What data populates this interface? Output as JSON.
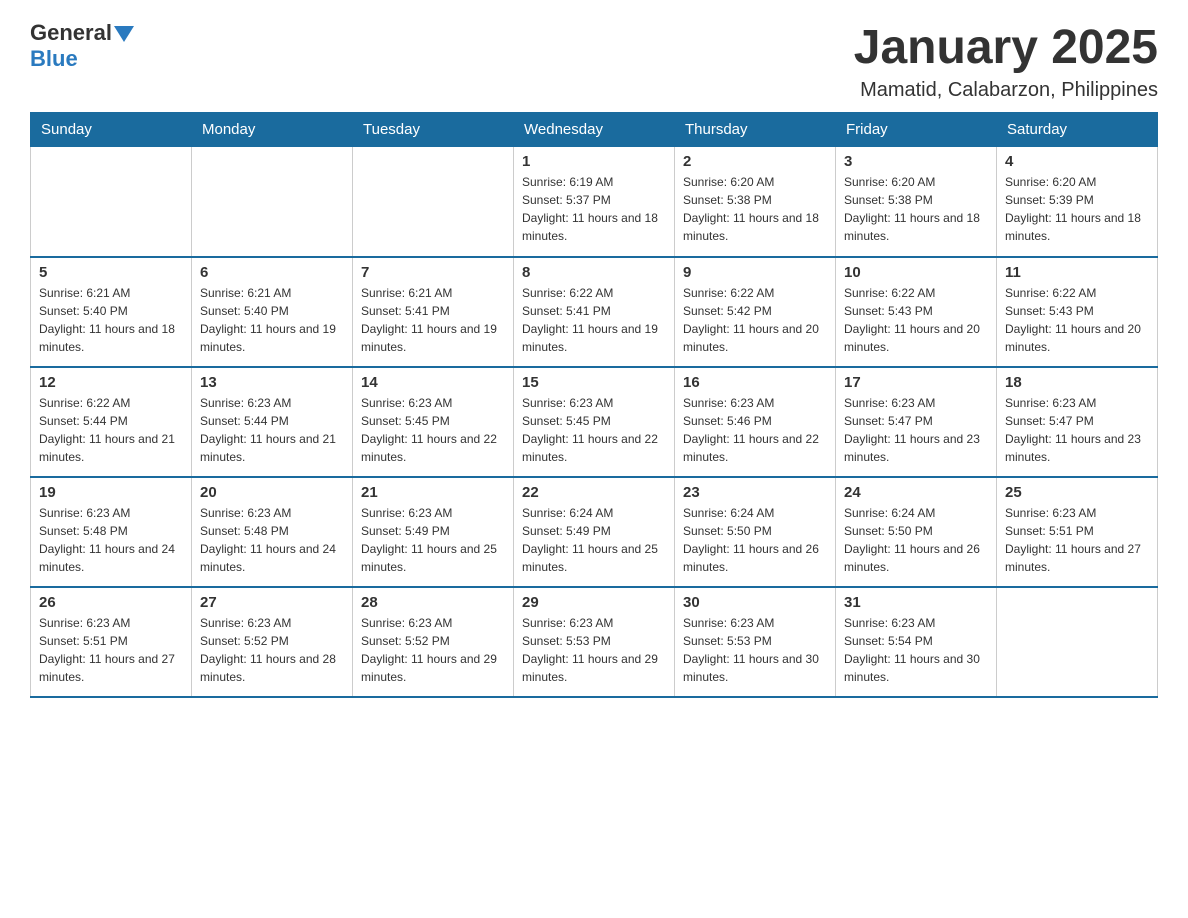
{
  "logo": {
    "general": "General",
    "blue": "Blue"
  },
  "header": {
    "title": "January 2025",
    "subtitle": "Mamatid, Calabarzon, Philippines"
  },
  "days_of_week": [
    "Sunday",
    "Monday",
    "Tuesday",
    "Wednesday",
    "Thursday",
    "Friday",
    "Saturday"
  ],
  "weeks": [
    [
      {
        "day": "",
        "info": ""
      },
      {
        "day": "",
        "info": ""
      },
      {
        "day": "",
        "info": ""
      },
      {
        "day": "1",
        "info": "Sunrise: 6:19 AM\nSunset: 5:37 PM\nDaylight: 11 hours and 18 minutes."
      },
      {
        "day": "2",
        "info": "Sunrise: 6:20 AM\nSunset: 5:38 PM\nDaylight: 11 hours and 18 minutes."
      },
      {
        "day": "3",
        "info": "Sunrise: 6:20 AM\nSunset: 5:38 PM\nDaylight: 11 hours and 18 minutes."
      },
      {
        "day": "4",
        "info": "Sunrise: 6:20 AM\nSunset: 5:39 PM\nDaylight: 11 hours and 18 minutes."
      }
    ],
    [
      {
        "day": "5",
        "info": "Sunrise: 6:21 AM\nSunset: 5:40 PM\nDaylight: 11 hours and 18 minutes."
      },
      {
        "day": "6",
        "info": "Sunrise: 6:21 AM\nSunset: 5:40 PM\nDaylight: 11 hours and 19 minutes."
      },
      {
        "day": "7",
        "info": "Sunrise: 6:21 AM\nSunset: 5:41 PM\nDaylight: 11 hours and 19 minutes."
      },
      {
        "day": "8",
        "info": "Sunrise: 6:22 AM\nSunset: 5:41 PM\nDaylight: 11 hours and 19 minutes."
      },
      {
        "day": "9",
        "info": "Sunrise: 6:22 AM\nSunset: 5:42 PM\nDaylight: 11 hours and 20 minutes."
      },
      {
        "day": "10",
        "info": "Sunrise: 6:22 AM\nSunset: 5:43 PM\nDaylight: 11 hours and 20 minutes."
      },
      {
        "day": "11",
        "info": "Sunrise: 6:22 AM\nSunset: 5:43 PM\nDaylight: 11 hours and 20 minutes."
      }
    ],
    [
      {
        "day": "12",
        "info": "Sunrise: 6:22 AM\nSunset: 5:44 PM\nDaylight: 11 hours and 21 minutes."
      },
      {
        "day": "13",
        "info": "Sunrise: 6:23 AM\nSunset: 5:44 PM\nDaylight: 11 hours and 21 minutes."
      },
      {
        "day": "14",
        "info": "Sunrise: 6:23 AM\nSunset: 5:45 PM\nDaylight: 11 hours and 22 minutes."
      },
      {
        "day": "15",
        "info": "Sunrise: 6:23 AM\nSunset: 5:45 PM\nDaylight: 11 hours and 22 minutes."
      },
      {
        "day": "16",
        "info": "Sunrise: 6:23 AM\nSunset: 5:46 PM\nDaylight: 11 hours and 22 minutes."
      },
      {
        "day": "17",
        "info": "Sunrise: 6:23 AM\nSunset: 5:47 PM\nDaylight: 11 hours and 23 minutes."
      },
      {
        "day": "18",
        "info": "Sunrise: 6:23 AM\nSunset: 5:47 PM\nDaylight: 11 hours and 23 minutes."
      }
    ],
    [
      {
        "day": "19",
        "info": "Sunrise: 6:23 AM\nSunset: 5:48 PM\nDaylight: 11 hours and 24 minutes."
      },
      {
        "day": "20",
        "info": "Sunrise: 6:23 AM\nSunset: 5:48 PM\nDaylight: 11 hours and 24 minutes."
      },
      {
        "day": "21",
        "info": "Sunrise: 6:23 AM\nSunset: 5:49 PM\nDaylight: 11 hours and 25 minutes."
      },
      {
        "day": "22",
        "info": "Sunrise: 6:24 AM\nSunset: 5:49 PM\nDaylight: 11 hours and 25 minutes."
      },
      {
        "day": "23",
        "info": "Sunrise: 6:24 AM\nSunset: 5:50 PM\nDaylight: 11 hours and 26 minutes."
      },
      {
        "day": "24",
        "info": "Sunrise: 6:24 AM\nSunset: 5:50 PM\nDaylight: 11 hours and 26 minutes."
      },
      {
        "day": "25",
        "info": "Sunrise: 6:23 AM\nSunset: 5:51 PM\nDaylight: 11 hours and 27 minutes."
      }
    ],
    [
      {
        "day": "26",
        "info": "Sunrise: 6:23 AM\nSunset: 5:51 PM\nDaylight: 11 hours and 27 minutes."
      },
      {
        "day": "27",
        "info": "Sunrise: 6:23 AM\nSunset: 5:52 PM\nDaylight: 11 hours and 28 minutes."
      },
      {
        "day": "28",
        "info": "Sunrise: 6:23 AM\nSunset: 5:52 PM\nDaylight: 11 hours and 29 minutes."
      },
      {
        "day": "29",
        "info": "Sunrise: 6:23 AM\nSunset: 5:53 PM\nDaylight: 11 hours and 29 minutes."
      },
      {
        "day": "30",
        "info": "Sunrise: 6:23 AM\nSunset: 5:53 PM\nDaylight: 11 hours and 30 minutes."
      },
      {
        "day": "31",
        "info": "Sunrise: 6:23 AM\nSunset: 5:54 PM\nDaylight: 11 hours and 30 minutes."
      },
      {
        "day": "",
        "info": ""
      }
    ]
  ]
}
